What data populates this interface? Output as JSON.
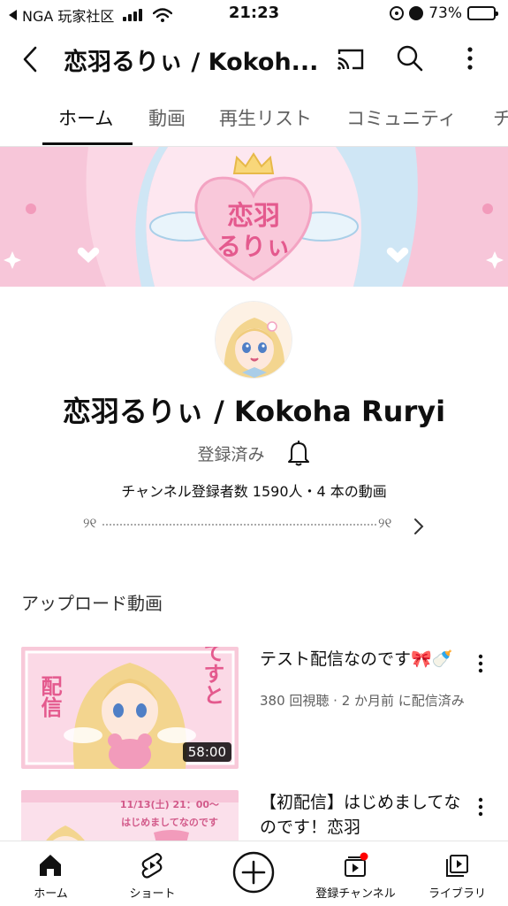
{
  "status_bar": {
    "carrier": "NGA 玩家社区",
    "time": "21:23",
    "battery": "73%",
    "battery_level": 0.73
  },
  "app_bar": {
    "title": "恋羽るりぃ / Kokoh...",
    "icons": [
      "back-arrow-icon",
      "cast-icon",
      "search-icon",
      "more-vert-icon"
    ]
  },
  "tabs": [
    {
      "label": "ホーム",
      "active": true
    },
    {
      "label": "動画"
    },
    {
      "label": "再生リスト"
    },
    {
      "label": "コミュニティ"
    },
    {
      "label": "チ"
    }
  ],
  "banner": {
    "logo_text": "恋羽るりぃ"
  },
  "channel": {
    "name": "恋羽るりぃ / Kokoha Ruryi",
    "subscribe_label": "登録済み",
    "stats": "チャンネル登録者数 1590人・4 本の動画",
    "link_deco_left": "୨୧",
    "link_deco_right": "୨୧"
  },
  "uploads": {
    "section_title": "アップロード動画",
    "videos": [
      {
        "title": "テスト配信なのです🎀🍼",
        "meta": "380 回視聴 · 2 か月前 に配信済み",
        "duration": "58:00",
        "thumb_text_left": "配信",
        "thumb_text_right": "てすと"
      },
      {
        "title": "【初配信】はじめましてなのです！恋羽",
        "thumb_text_top": "11/13(土) 21：00～",
        "thumb_text_sub": "はじめましてなのです"
      }
    ]
  },
  "bottom_nav": [
    {
      "label": "ホーム",
      "icon": "home-icon"
    },
    {
      "label": "ショート",
      "icon": "shorts-icon"
    },
    {
      "label": "",
      "icon": "create-icon"
    },
    {
      "label": "登録チャンネル",
      "icon": "subscriptions-icon"
    },
    {
      "label": "ライブラリ",
      "icon": "library-icon"
    }
  ],
  "colors": {
    "accent": "#0f0f0f",
    "secondary_text": "#606060",
    "banner_pink": "#f7c6d9",
    "banner_blue": "#cfe6f5",
    "notification_dot": "#ff0000"
  }
}
